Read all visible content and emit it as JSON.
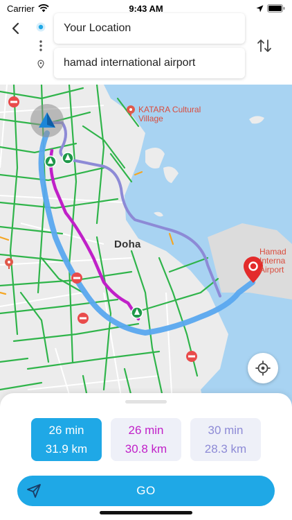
{
  "status_bar": {
    "carrier": "Carrier",
    "time": "9:43 AM"
  },
  "search": {
    "from_value": "Your Location",
    "to_value": "hamad international airport"
  },
  "map": {
    "poi_katara_line1": "KATARA Cultural",
    "poi_katara_line2": "Village",
    "city_label": "Doha",
    "poi_airport_line1": "Hamad",
    "poi_airport_line2": "Interna",
    "poi_airport_line3": "Airport"
  },
  "routes": [
    {
      "time": "26 min",
      "distance": "31.9 km",
      "color": "#1fa8e6",
      "selected": true
    },
    {
      "time": "26 min",
      "distance": "30.8 km",
      "color": "#c020c8",
      "selected": false
    },
    {
      "time": "30 min",
      "distance": "28.3 km",
      "color": "#8d8ad6",
      "selected": false
    }
  ],
  "go_label": "GO",
  "icons": [
    "wifi-icon",
    "back-chevron-icon",
    "origin-dot-icon",
    "destination-pin-icon",
    "swap-icon",
    "navigation-arrow-icon",
    "locate-icon",
    "send-icon"
  ]
}
